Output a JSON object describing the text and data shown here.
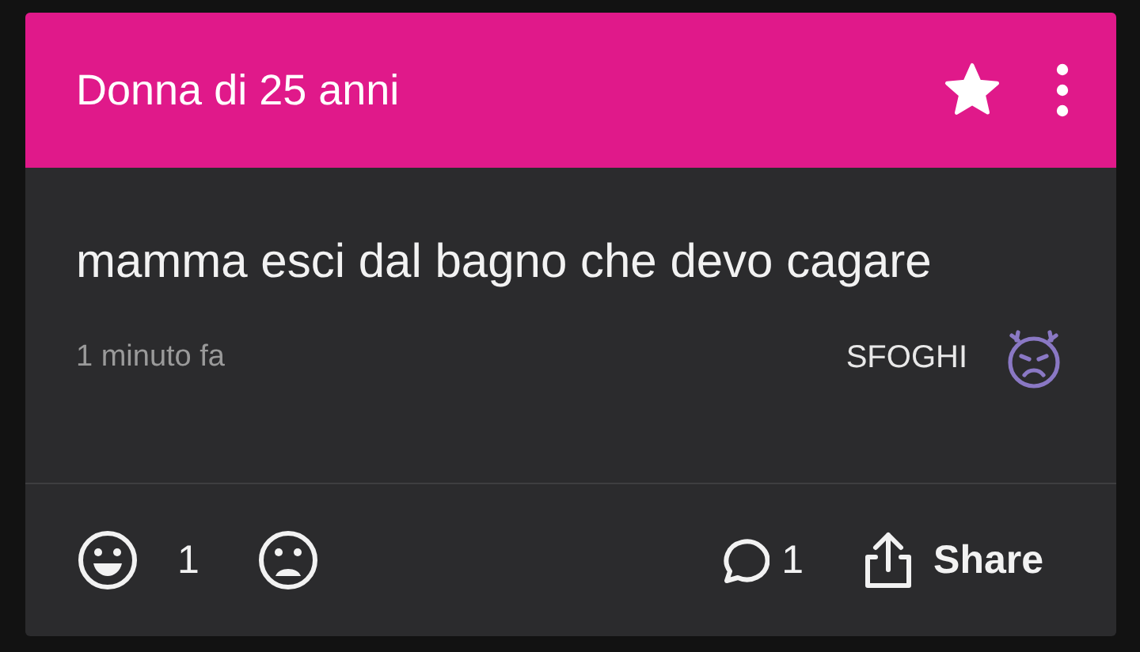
{
  "header": {
    "title": "Donna di 25 anni",
    "starred": true
  },
  "post": {
    "text": "mamma esci dal bagno che devo cagare",
    "time": "1 minuto fa",
    "category": {
      "label": "SFOGHI",
      "color": "#8a78c4"
    }
  },
  "actions": {
    "likes": "1",
    "comments": "1",
    "share": "Share"
  }
}
